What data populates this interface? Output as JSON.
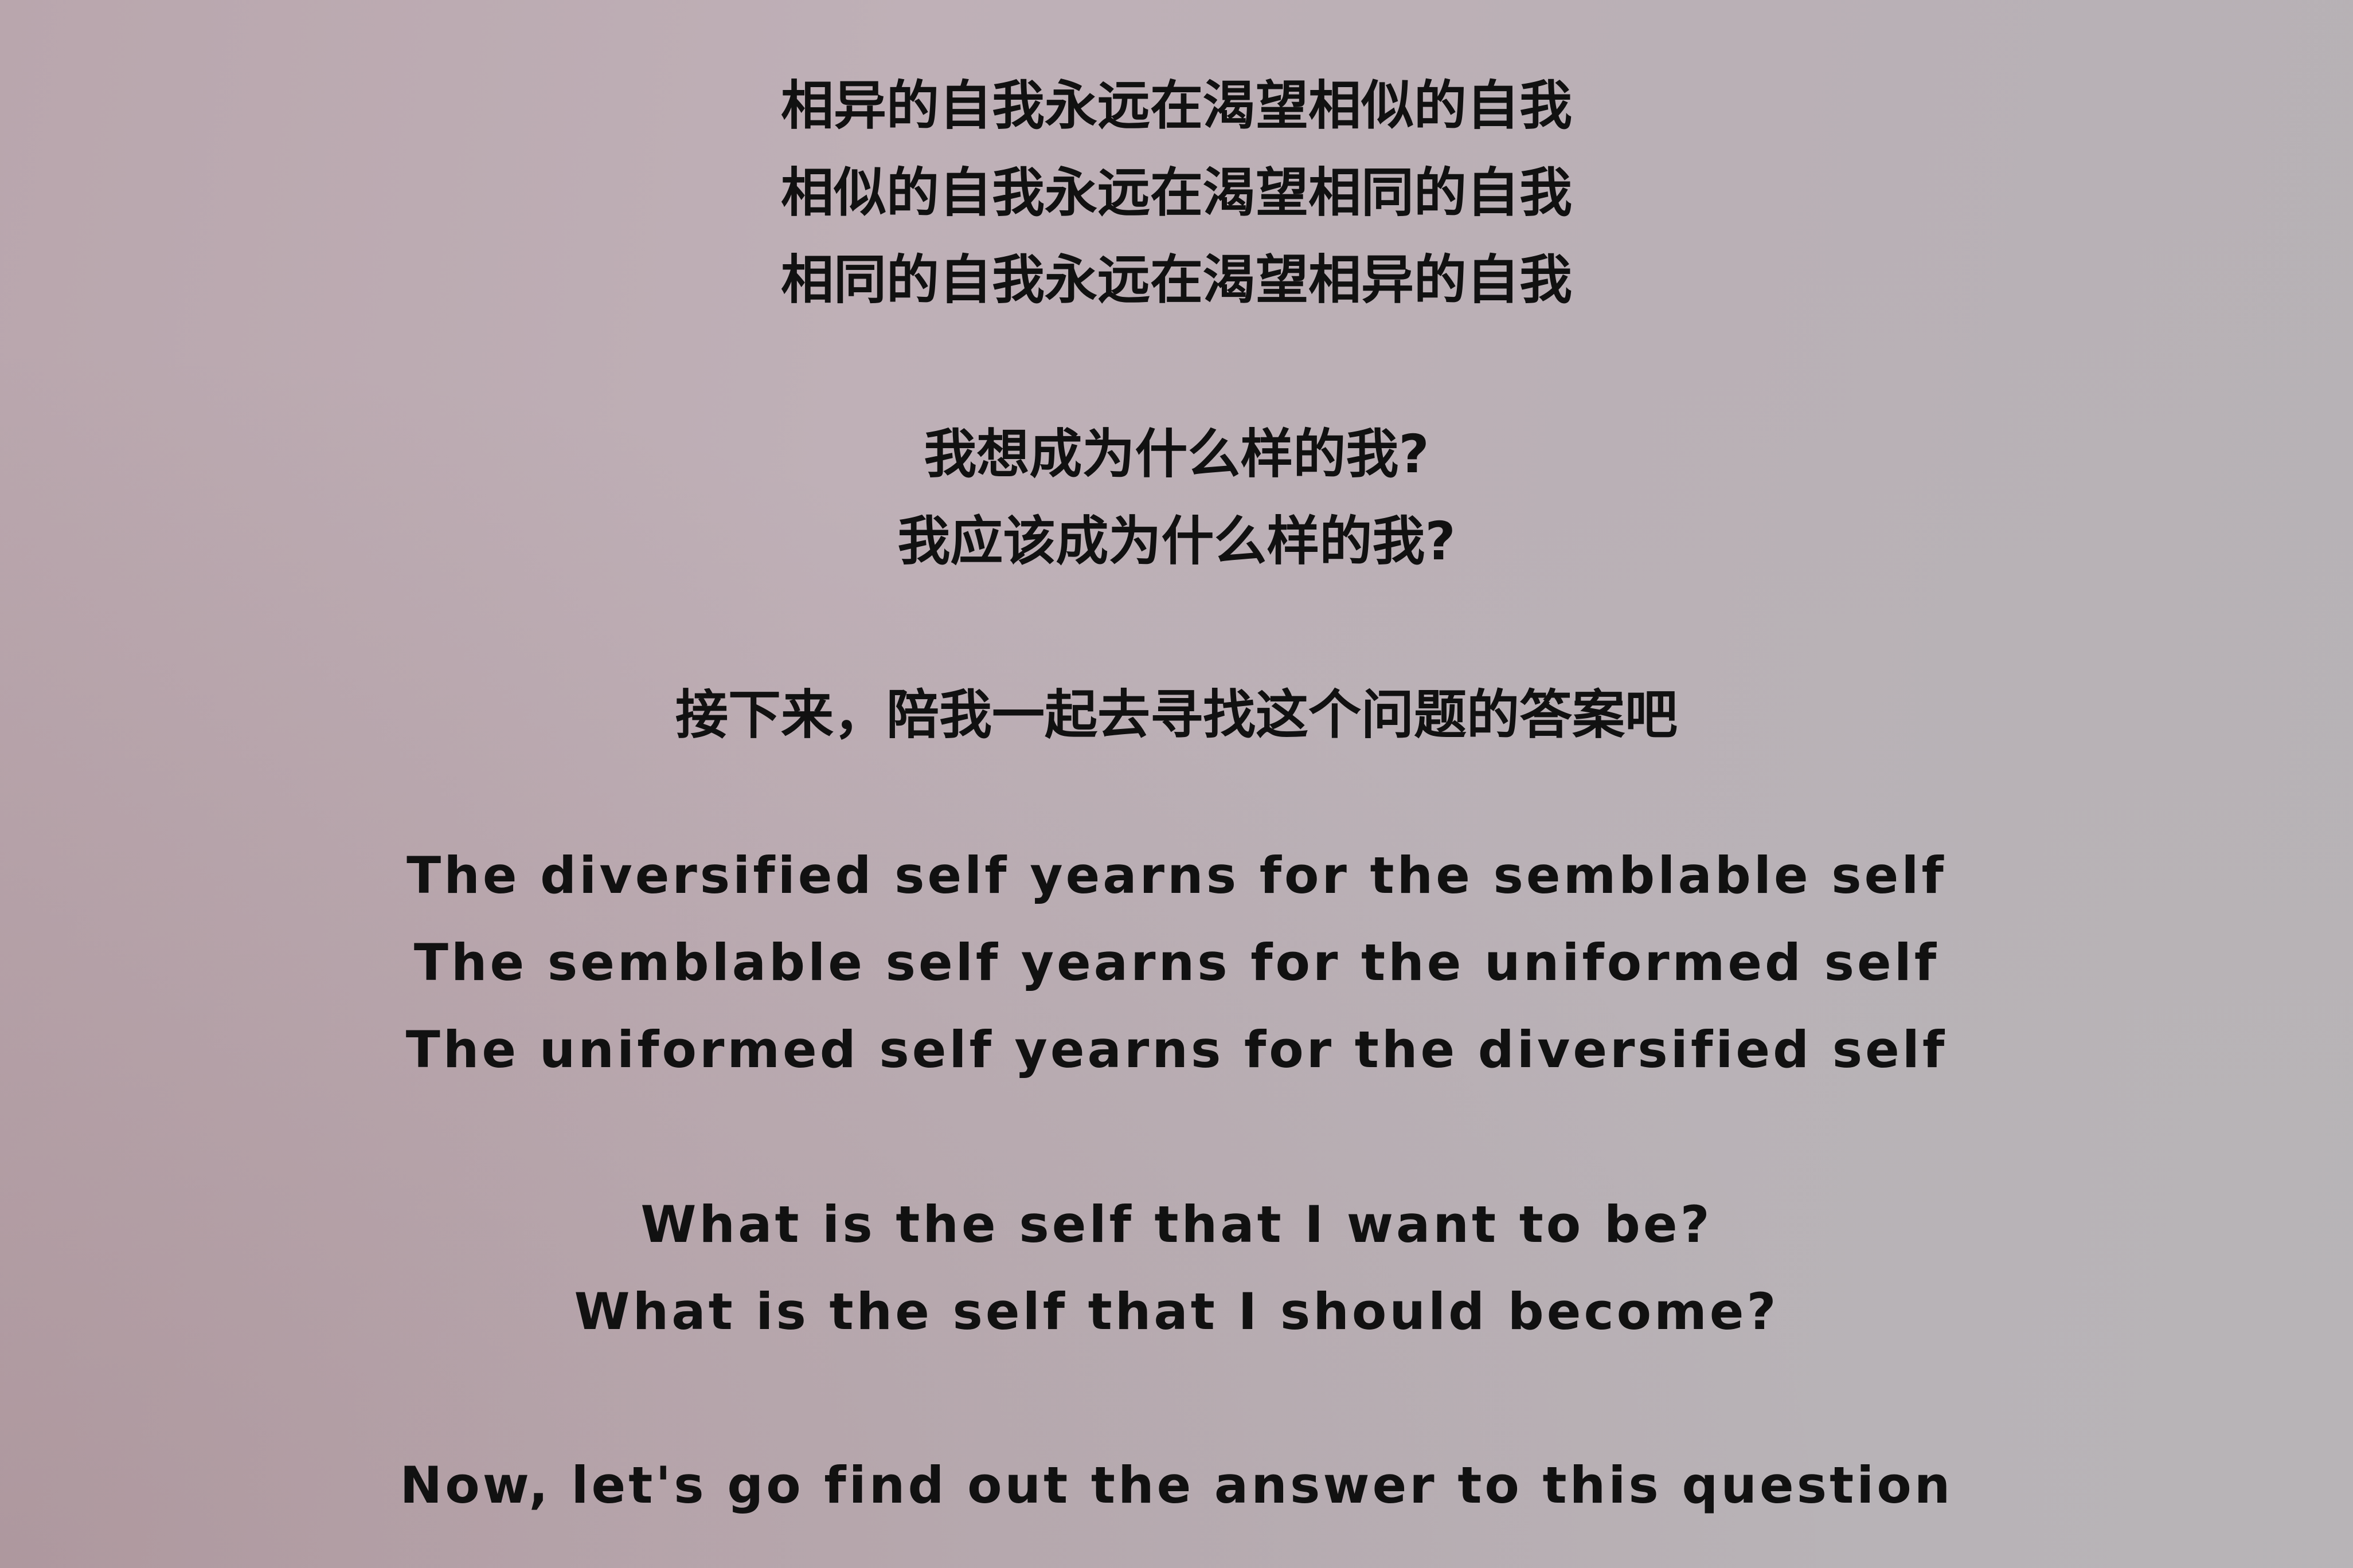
{
  "wall_text": {
    "chinese_stanza_1": [
      "相异的自我永远在渴望相似的自我",
      "相似的自我永远在渴望相同的自我",
      "相同的自我永远在渴望相异的自我"
    ],
    "chinese_stanza_2": [
      "我想成为什么样的我?",
      "我应该成为什么样的我?"
    ],
    "chinese_stanza_3": "接下来，陪我一起去寻找这个问题的答案吧",
    "english_stanza_1": [
      "The diversified self yearns for the semblable self",
      "The semblable self yearns for the uniformed self",
      "The uniformed self yearns for the diversified self"
    ],
    "english_stanza_2": [
      "What is the self that I want to be?",
      "What is the self that I should become?"
    ],
    "english_stanza_3": "Now, let's go find out the answer to this question"
  },
  "colors": {
    "text": "#111111",
    "wall": "#bcaeb4"
  }
}
